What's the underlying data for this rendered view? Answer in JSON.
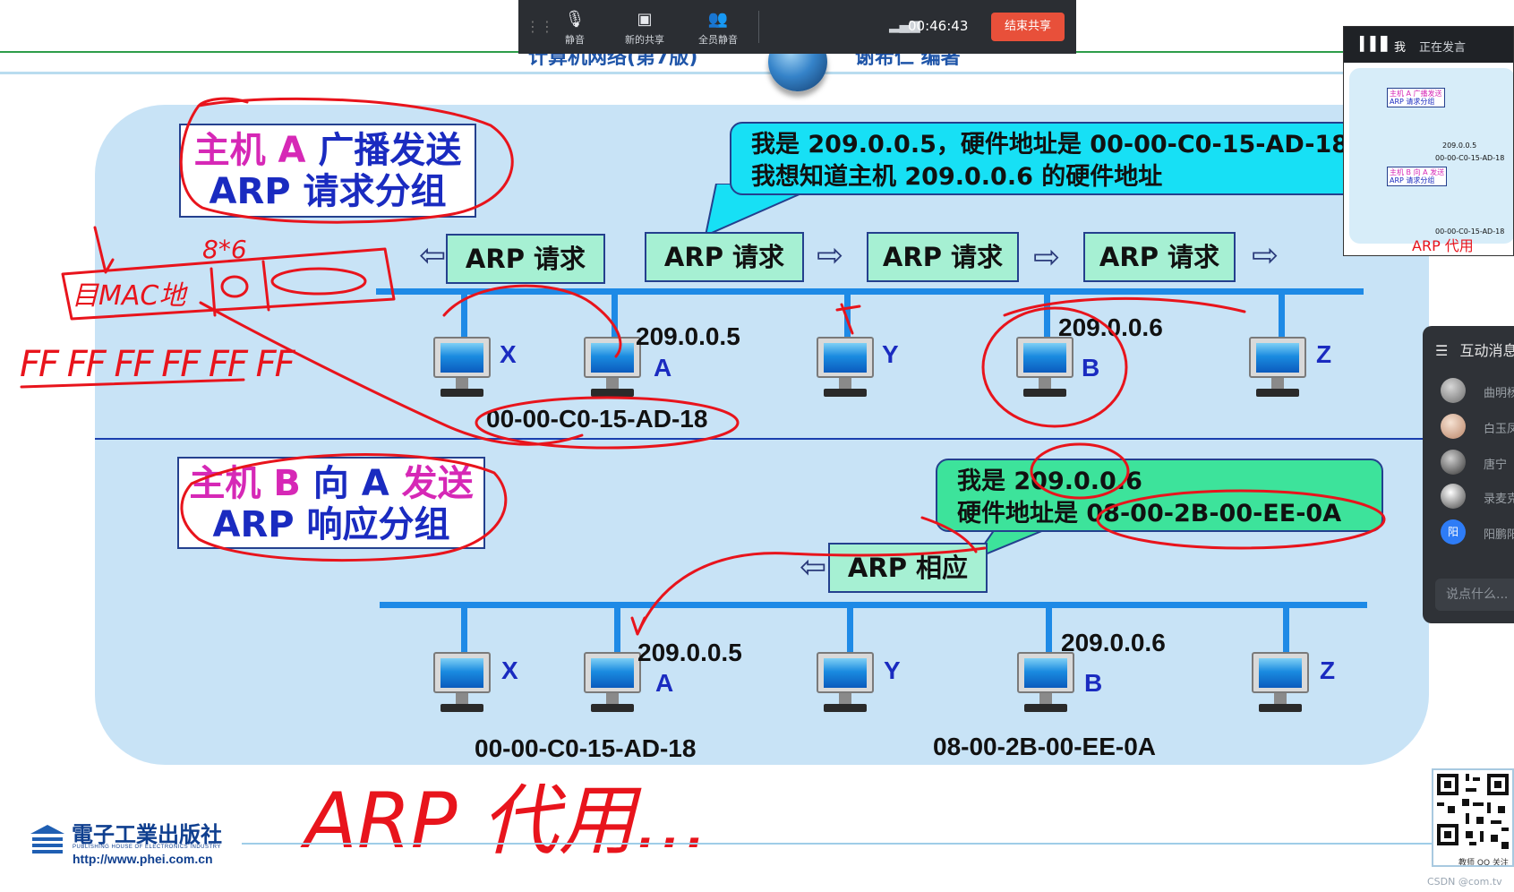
{
  "slide_header": {
    "left_title": "计算机网络(第7版)",
    "right_title": "谢希仁 编著"
  },
  "request_section": {
    "title_line1_magenta": "主机 A ",
    "title_line1_blue": "广播发送",
    "title_line2": "ARP 请求分组",
    "callout_line1": "我是 209.0.0.5，硬件地址是 00-00-C0-15-AD-18",
    "callout_line2": "我想知道主机 209.0.0.6 的硬件地址",
    "arp_label": "ARP 请求",
    "hosts": [
      {
        "name": "X"
      },
      {
        "name": "A",
        "ip": "209.0.0.5",
        "mac": "00-00-C0-15-AD-18"
      },
      {
        "name": "Y"
      },
      {
        "name": "B",
        "ip": "209.0.0.6"
      },
      {
        "name": "Z"
      }
    ]
  },
  "response_section": {
    "title_line1_magenta": "主机 B ",
    "title_line1_blue": "向 A ",
    "title_line1_magenta2": "发送",
    "title_line2": "ARP 响应分组",
    "callout_line1": "我是 209.0.0.6",
    "callout_line2": "硬件地址是 08-00-2B-00-EE-0A",
    "arp_label": "ARP 相应",
    "hosts": [
      {
        "name": "X"
      },
      {
        "name": "A",
        "ip": "209.0.0.5",
        "mac": "00-00-C0-15-AD-18"
      },
      {
        "name": "Y"
      },
      {
        "name": "B",
        "ip": "209.0.0.6",
        "mac": "08-00-2B-00-EE-0A"
      },
      {
        "name": "Z"
      }
    ]
  },
  "handwriting": {
    "mac_note": "目MAC地",
    "bytes_note": "8*6",
    "ff_row": "FF FF FF FF FF FF",
    "arp_note": "ARP 代用..."
  },
  "meeting_toolbar": {
    "mute_label": "静音",
    "share_label": "新的共享",
    "mute_all_label": "全员静音",
    "timer": "00:46:43",
    "stop_share_label": "结束共享"
  },
  "speaker_panel": {
    "me_label": "我",
    "status": "正在发言",
    "thumb_title1": "主机 A 广播发送",
    "thumb_title1b": "ARP 请求分组",
    "thumb_title2": "主机 B 向 A 发送",
    "thumb_title2b": "ARP 请求分组",
    "thumb_ip": "209.0.0.5",
    "thumb_mac": "00-00-C0-15-AD-18",
    "thumb_note": "ARP 代用"
  },
  "chat_panel": {
    "title": "互动消息",
    "users": [
      "曲明杨",
      "白玉凤",
      "唐宁",
      "录麦克",
      "阳鹏阳"
    ],
    "avatar_letter": "阳",
    "input_placeholder": "说点什么..."
  },
  "footer": {
    "publisher_cn": "電子工業出版社",
    "publisher_en": "PUBLISHING HOUSE OF ELECTRONICS INDUSTRY",
    "url": "http://www.phei.com.cn",
    "qr_caption": "教师 QQ 关注",
    "watermark": "CSDN @com.tv"
  },
  "colors": {
    "panel_bg": "#c8e3f6",
    "bus_blue": "#1e8ae6",
    "arp_box": "#a6f0d3",
    "callout_cyan": "#17e0f5",
    "callout_green": "#3de39b",
    "title_magenta": "#d628b6",
    "title_blue": "#1a2bc0",
    "ink_red": "#e8141c",
    "stop_button": "#e8503a"
  }
}
